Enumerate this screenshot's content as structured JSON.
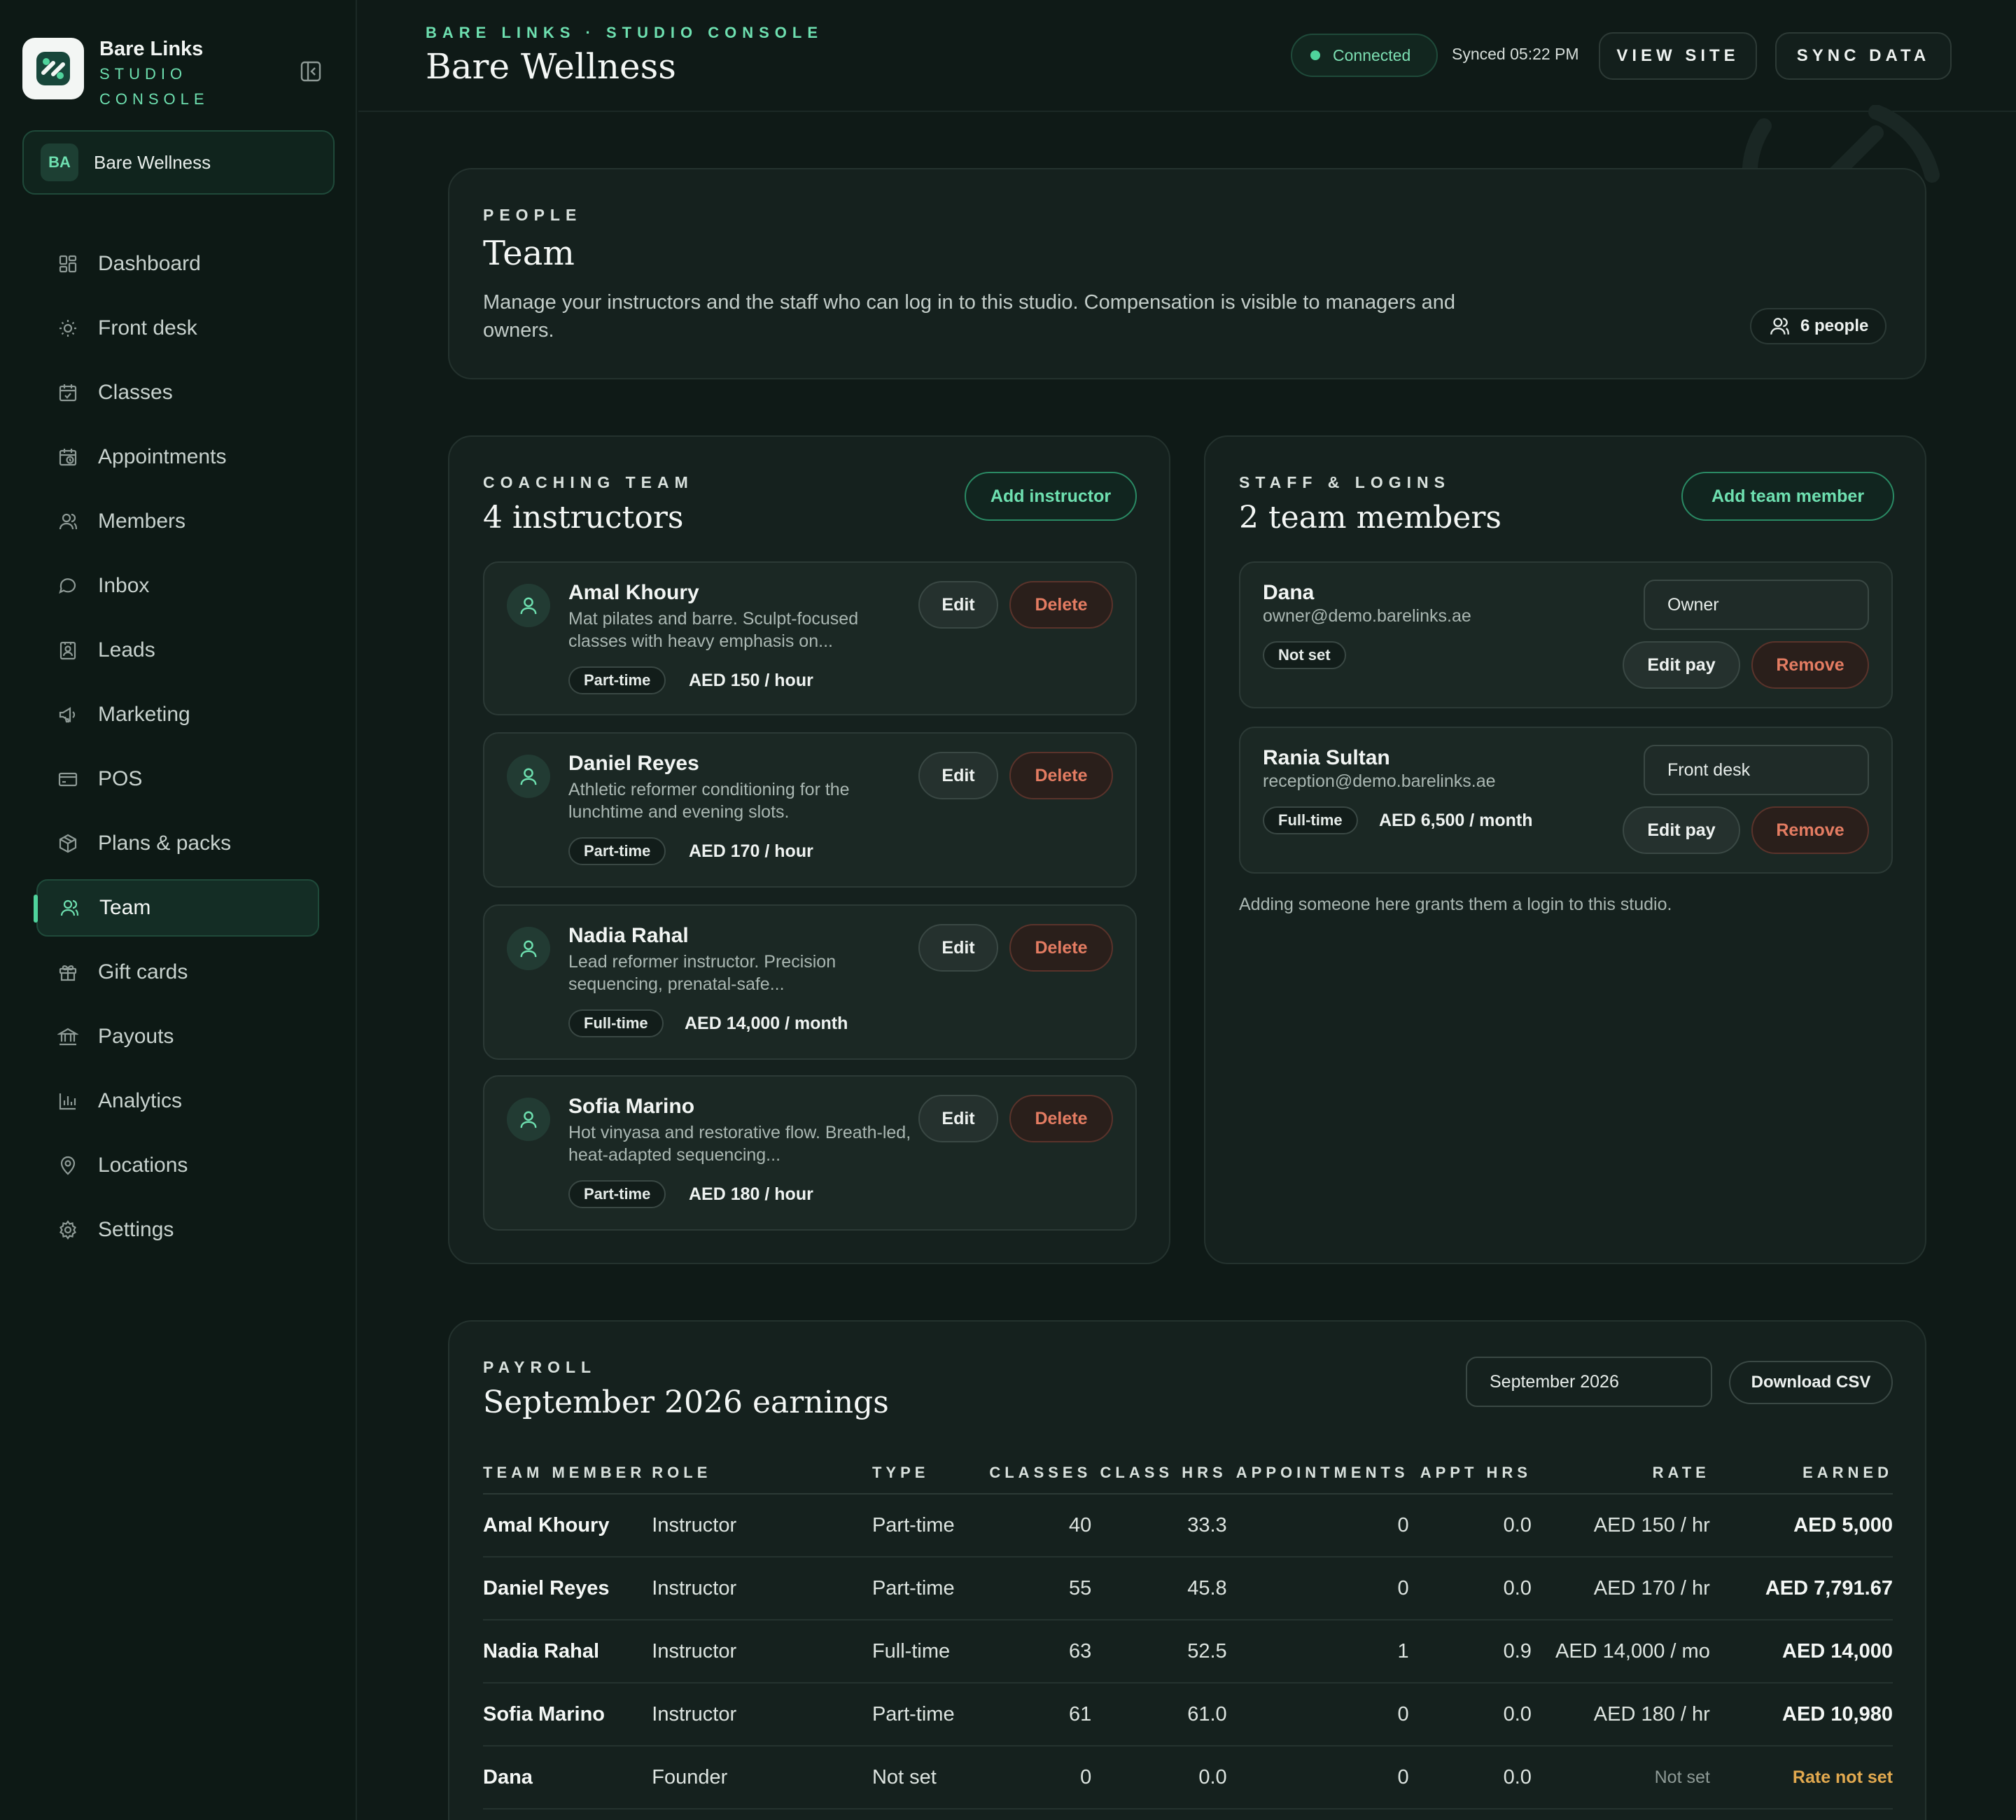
{
  "brand": {
    "name": "Bare Links",
    "sub_line1": "STUDIO",
    "sub_line2": "CONSOLE"
  },
  "studio": {
    "initials": "BA",
    "name": "Bare Wellness"
  },
  "nav": [
    {
      "label": "Dashboard",
      "icon": "grid-icon"
    },
    {
      "label": "Front desk",
      "icon": "sun-icon"
    },
    {
      "label": "Classes",
      "icon": "calendar-icon"
    },
    {
      "label": "Appointments",
      "icon": "calendar-clock-icon"
    },
    {
      "label": "Members",
      "icon": "user-icon"
    },
    {
      "label": "Inbox",
      "icon": "chat-bubble-icon"
    },
    {
      "label": "Leads",
      "icon": "contact-card-icon"
    },
    {
      "label": "Marketing",
      "icon": "megaphone-icon"
    },
    {
      "label": "POS",
      "icon": "credit-card-icon"
    },
    {
      "label": "Plans & packs",
      "icon": "package-icon"
    },
    {
      "label": "Team",
      "icon": "team-icon",
      "active": true
    },
    {
      "label": "Gift cards",
      "icon": "gift-icon"
    },
    {
      "label": "Payouts",
      "icon": "bank-icon"
    },
    {
      "label": "Analytics",
      "icon": "bar-chart-icon"
    },
    {
      "label": "Locations",
      "icon": "map-pin-icon"
    },
    {
      "label": "Settings",
      "icon": "gear-icon"
    }
  ],
  "header": {
    "eyebrow": "BARE LINKS · STUDIO CONSOLE",
    "title": "Bare Wellness",
    "status": "Connected",
    "synced": "Synced 05:22 PM",
    "view_site": "VIEW SITE",
    "sync_data": "SYNC DATA"
  },
  "people": {
    "label": "PEOPLE",
    "title": "Team",
    "description": "Manage your instructors and the staff who can log in to this studio. Compensation is visible to managers and owners.",
    "count": "6 people"
  },
  "coaching": {
    "label": "COACHING TEAM",
    "title": "4 instructors",
    "add_label": "Add instructor",
    "edit_label": "Edit",
    "delete_label": "Delete",
    "instructors": [
      {
        "name": "Amal Khoury",
        "desc": "Mat pilates and barre. Sculpt-focused classes with heavy emphasis on...",
        "type": "Part-time",
        "rate": "AED 150 / hour"
      },
      {
        "name": "Daniel Reyes",
        "desc": "Athletic reformer conditioning for the lunchtime and evening slots.",
        "type": "Part-time",
        "rate": "AED 170 / hour"
      },
      {
        "name": "Nadia Rahal",
        "desc": "Lead reformer instructor. Precision sequencing, prenatal-safe...",
        "type": "Full-time",
        "rate": "AED 14,000 / month"
      },
      {
        "name": "Sofia Marino",
        "desc": "Hot vinyasa and restorative flow. Breath-led, heat-adapted sequencing...",
        "type": "Part-time",
        "rate": "AED 180 / hour"
      }
    ]
  },
  "staff": {
    "label": "STAFF & LOGINS",
    "title": "2 team members",
    "add_label": "Add team member",
    "edit_pay_label": "Edit pay",
    "remove_label": "Remove",
    "members": [
      {
        "name": "Dana",
        "email": "owner@demo.barelinks.ae",
        "role": "Owner",
        "pay": "Not set",
        "rate": ""
      },
      {
        "name": "Rania Sultan",
        "email": "reception@demo.barelinks.ae",
        "role": "Front desk",
        "pay": "Full-time",
        "rate": "AED 6,500 / month"
      }
    ],
    "note": "Adding someone here grants them a login to this studio."
  },
  "payroll": {
    "label": "PAYROLL",
    "title": "September 2026 earnings",
    "month": "September 2026",
    "download": "Download CSV",
    "columns": [
      "TEAM MEMBER",
      "ROLE",
      "TYPE",
      "CLASSES",
      "CLASS HRS",
      "APPOINTMENTS",
      "APPT HRS",
      "RATE",
      "EARNED"
    ],
    "rows": [
      {
        "name": "Amal Khoury",
        "role": "Instructor",
        "type": "Part-time",
        "classes": "40",
        "class_hrs": "33.3",
        "appointments": "0",
        "appt_hrs": "0.0",
        "rate": "AED 150 / hr",
        "earned": "AED 5,000"
      },
      {
        "name": "Daniel Reyes",
        "role": "Instructor",
        "type": "Part-time",
        "classes": "55",
        "class_hrs": "45.8",
        "appointments": "0",
        "appt_hrs": "0.0",
        "rate": "AED 170 / hr",
        "earned": "AED 7,791.67"
      },
      {
        "name": "Nadia Rahal",
        "role": "Instructor",
        "type": "Full-time",
        "classes": "63",
        "class_hrs": "52.5",
        "appointments": "1",
        "appt_hrs": "0.9",
        "rate": "AED 14,000 / mo",
        "earned": "AED 14,000"
      },
      {
        "name": "Sofia Marino",
        "role": "Instructor",
        "type": "Part-time",
        "classes": "61",
        "class_hrs": "61.0",
        "appointments": "0",
        "appt_hrs": "0.0",
        "rate": "AED 180 / hr",
        "earned": "AED 10,980"
      },
      {
        "name": "Dana",
        "role": "Founder",
        "type": "Not set",
        "classes": "0",
        "class_hrs": "0.0",
        "appointments": "0",
        "appt_hrs": "0.0",
        "rate": "Not set",
        "earned": "Rate not set"
      }
    ]
  },
  "colors": {
    "accent": "#4fd39c",
    "danger": "#e47c62",
    "warning": "#e2a94f",
    "background": "#0f1a17"
  }
}
